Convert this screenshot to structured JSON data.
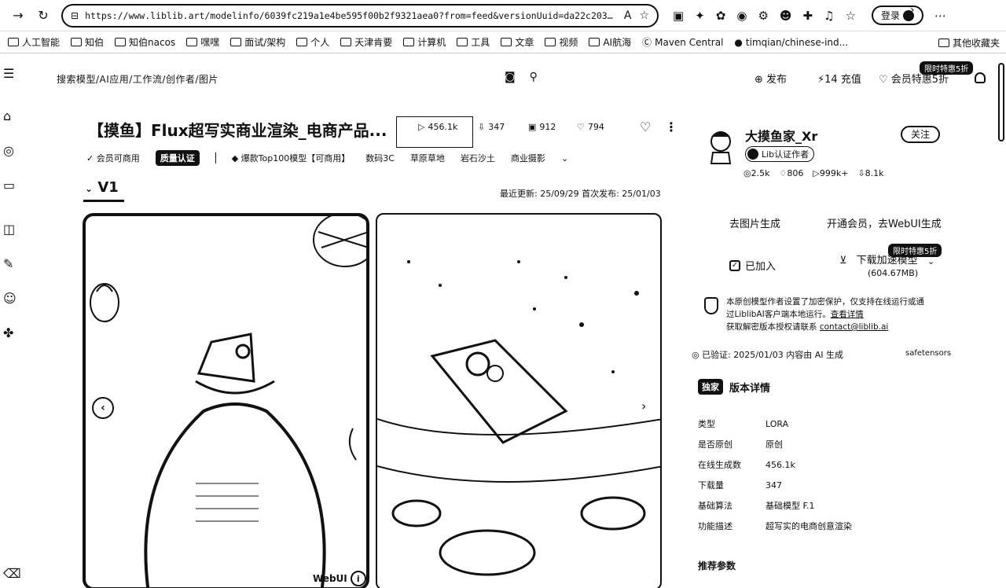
{
  "browser": {
    "url": "https://www.liblib.art/modelinfo/6039fc219a1e4be595f00b2f9321aea0?from=feed&versionUuid=da22c2037c65461...",
    "read_aloud_icon": "A",
    "login_label": "登录"
  },
  "bookmarks": {
    "items": [
      "人工智能",
      "知伯",
      "知伯nacos",
      "嘿嘿",
      "面试/架构",
      "个人",
      "天津肯要",
      "计算机",
      "工具",
      "文章",
      "视频",
      "AI航海",
      "Maven Central",
      "timqian/chinese-ind..."
    ],
    "other_label": "其他收藏夹"
  },
  "header": {
    "breadcrumb": "搜索模型/AI应用/工作流/创作者/图片",
    "publish": "发布",
    "recharge": "14 充值",
    "vip_sale": "会员特惠5折",
    "flash_badge": "限时特惠5折"
  },
  "model": {
    "title": "【摸鱼】Flux超写实商业渲染_电商产品...",
    "runs": "456.1k",
    "downloads": "347",
    "images": "912",
    "likes": "794"
  },
  "tags": {
    "commercial": "会员可商用",
    "quality": "质量认证",
    "top100": "爆款Top100模型【可商用】",
    "digital": "数码3C",
    "grass": "草原草地",
    "rock": "岩石沙土",
    "photo": "商业摄影"
  },
  "version": {
    "name": "V1",
    "dates": "最近更新: 25/09/29   首次发布: 25/01/03"
  },
  "gallery": {
    "webui_label": "WebUI"
  },
  "author": {
    "name": "大摸鱼家_Xr",
    "follow_label": "关注",
    "cert_label": "Lib认证作者",
    "stats": [
      "2.5k",
      "806",
      "999k+",
      "8.1k"
    ]
  },
  "actions": {
    "generate": "去图片生成",
    "webui": "开通会员，去WebUI生成",
    "added": "已加入",
    "download": "下载加速模型",
    "download_size": "(604.67MB)",
    "flash_badge": "限时特惠5折"
  },
  "protection": {
    "line1": "本原创模型作者设置了加密保护，仅支持在线运行或通",
    "line2_prefix": "过LiblibAI客户端本地运行。",
    "line2_link": "查看详情",
    "line3_prefix": "获取解密版本授权请联系 ",
    "line3_link": "contact@liblib.ai"
  },
  "verification": {
    "text": "已验证: 2025/01/03 内容由 AI 生成",
    "format": "safetensors"
  },
  "version_detail": {
    "badge": "独家",
    "title": "版本详情",
    "rows": [
      {
        "label": "类型",
        "value": "LORA"
      },
      {
        "label": "是否原创",
        "value": "原创"
      },
      {
        "label": "在线生成数",
        "value": "456.1k"
      },
      {
        "label": "下载量",
        "value": "347"
      },
      {
        "label": "基础算法",
        "value": "基础模型 F.1"
      },
      {
        "label": "功能描述",
        "value": "超写实的电商创意渲染"
      }
    ]
  },
  "recommend": "推荐参数"
}
